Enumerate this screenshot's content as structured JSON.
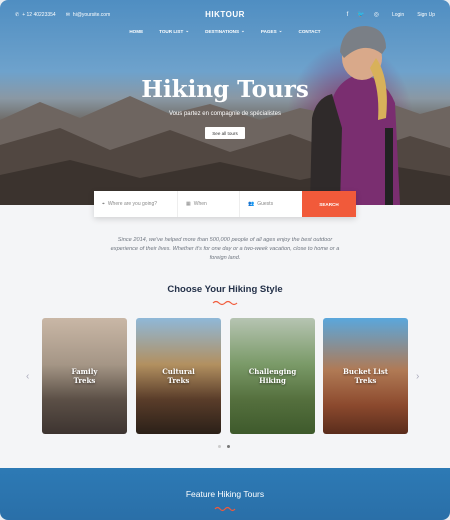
{
  "topbar": {
    "phone": "+ 12 40223354",
    "email": "hi@yoursite.com",
    "brand": "HIKTOUR",
    "login": "Login",
    "signup": "Sign Up"
  },
  "nav": {
    "items": [
      "HOME",
      "TOUR LIST",
      "DESTINATIONS",
      "PAGES",
      "CONTACT"
    ]
  },
  "hero": {
    "title": "Hiking Tours",
    "subtitle": "Vous partez en compagnie de spécialistes",
    "button": "See all tours"
  },
  "search": {
    "where_placeholder": "Where are you going?",
    "when_placeholder": "When",
    "guests_placeholder": "Guests",
    "button": "SEARCH"
  },
  "intro": {
    "text": "Since 2014, we've helped more than 500,000 people of all ages enjoy the best outdoor experience of their lives. Whether it's for one day or a two-week vacation, close to home or a foreign land."
  },
  "styles": {
    "title": "Choose Your Hiking Style",
    "cards": [
      {
        "label_1": "Family",
        "label_2": "Treks"
      },
      {
        "label_1": "Cultural",
        "label_2": "Treks"
      },
      {
        "label_1": "Challenging",
        "label_2": "Hiking"
      },
      {
        "label_1": "Bucket List",
        "label_2": "Treks"
      }
    ]
  },
  "feature": {
    "title": "Feature Hiking Tours"
  },
  "colors": {
    "accent": "#f15a3a",
    "band": "#2d7ab5",
    "heading": "#25324a"
  }
}
